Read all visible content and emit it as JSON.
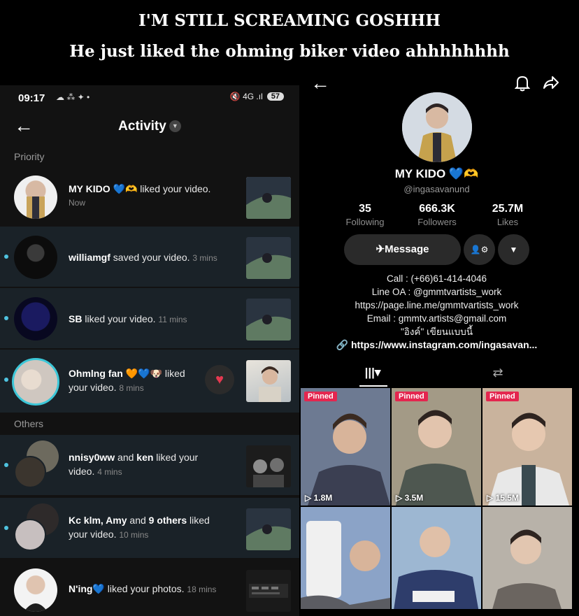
{
  "captions": {
    "line1": "I'M STILL SCREAMING GOSHHH",
    "line2": "He just liked the ohming biker  video ahhhhhhhh"
  },
  "activity": {
    "status_bar": {
      "time": "09:17",
      "left_icons": "☁ ⁂ ✦ •",
      "right_icons": "🔇 4G .ıl",
      "battery": "57"
    },
    "title": "Activity",
    "back_icon": "arrow-left-icon",
    "sections": {
      "priority": "Priority",
      "others": "Others"
    },
    "items": [
      {
        "name": "MY KIDO 💙🫶",
        "action": " liked your video.",
        "time": "Now",
        "unread": false
      },
      {
        "name": "williamgf",
        "action": " saved your video.",
        "time": "3 mins",
        "unread": true
      },
      {
        "name": "SB",
        "action": " liked your video.",
        "time": "11 mins",
        "unread": true
      },
      {
        "name": "Ohmlng fan 🧡💙🐶",
        "action": " liked",
        "line2": "your video.",
        "time": "8 mins",
        "unread": true,
        "heart": "♥"
      },
      {
        "name": "nnisy0ww",
        "action": " and ",
        "name2": "ken",
        "action2": " liked your",
        "line2": "video.",
        "time": "4 mins",
        "unread": true
      },
      {
        "name": "Kc klm, Amy",
        "action": " and ",
        "name2": "9 others",
        "action2": " liked",
        "line2": "your video.",
        "time": "10 mins",
        "unread": true
      },
      {
        "name": "N'ing💙",
        "action": " liked your photos.",
        "time": "18 mins",
        "unread": false
      }
    ]
  },
  "profile": {
    "back_icon": "arrow-left-icon",
    "bell_icon": "bell-icon",
    "share_icon": "share-icon",
    "name": "MY KIDO 💙🫶",
    "handle": "@ingasavanund",
    "stats": [
      {
        "value": "35",
        "label": "Following"
      },
      {
        "value": "666.3K",
        "label": "Followers"
      },
      {
        "value": "25.7M",
        "label": "Likes"
      }
    ],
    "message_button": "Message",
    "message_icon": "✈",
    "add_friend_icon": "👤⚙",
    "more_icon": "▼",
    "bio": [
      "Call : (+66)61-414-4046",
      "Line OA : @gmmtvartists_work",
      "https://page.line.me/gmmtvartists_work",
      "Email : gmmtv.artists@gmail.com",
      "\"อิงค์\" เขียนแบบนี้"
    ],
    "link": "🔗 https://www.instagram.com/ingasavan...",
    "tabs": {
      "videos": "|||▾",
      "reposts": "⇄"
    },
    "videos": [
      {
        "pinned": "Pinned",
        "views": "▷ 1.8M",
        "color1": "#6d7a92",
        "color2": "#3b3f52"
      },
      {
        "pinned": "Pinned",
        "views": "▷ 3.5M",
        "color1": "#a39a86",
        "color2": "#4e5750"
      },
      {
        "pinned": "Pinned",
        "views": "▷ 15.5M",
        "color1": "#c9b39d",
        "color2": "#5e6b73"
      },
      {
        "pinned": "",
        "views": "",
        "color1": "#8ba3c7",
        "color2": "#5b5c62"
      },
      {
        "pinned": "",
        "views": "",
        "color1": "#9db7d2",
        "color2": "#2e3d6b"
      },
      {
        "pinned": "",
        "views": "",
        "color1": "#b8b2a9",
        "color2": "#6b6560"
      }
    ]
  }
}
